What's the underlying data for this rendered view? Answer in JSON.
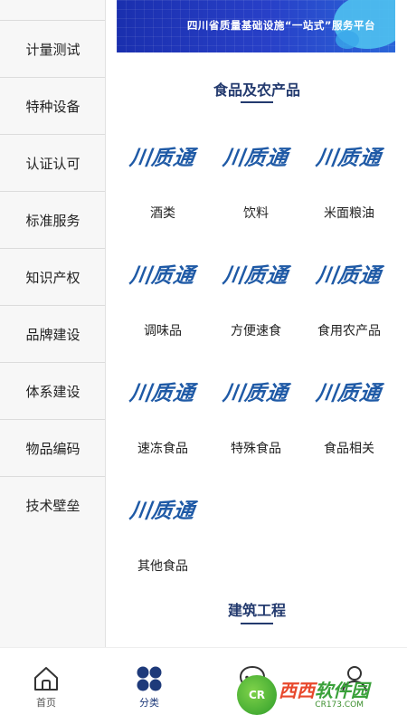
{
  "sidebar": {
    "items": [
      {
        "label": "计量测试"
      },
      {
        "label": "特种设备"
      },
      {
        "label": "认证认可"
      },
      {
        "label": "标准服务"
      },
      {
        "label": "知识产权"
      },
      {
        "label": "品牌建设"
      },
      {
        "label": "体系建设"
      },
      {
        "label": "物品编码"
      },
      {
        "label": "技术壁垒"
      }
    ]
  },
  "banner": {
    "text": "四川省质量基础设施“一站式”服务平台"
  },
  "sections": [
    {
      "title": "食品及农产品",
      "items": [
        {
          "logo": "川质通",
          "label": "酒类"
        },
        {
          "logo": "川质通",
          "label": "饮料"
        },
        {
          "logo": "川质通",
          "label": "米面粮油"
        },
        {
          "logo": "川质通",
          "label": "调味品"
        },
        {
          "logo": "川质通",
          "label": "方便速食"
        },
        {
          "logo": "川质通",
          "label": "食用农产品"
        },
        {
          "logo": "川质通",
          "label": "速冻食品"
        },
        {
          "logo": "川质通",
          "label": "特殊食品"
        },
        {
          "logo": "川质通",
          "label": "食品相关"
        },
        {
          "logo": "川质通",
          "label": "其他食品"
        }
      ]
    },
    {
      "title": "建筑工程",
      "items": []
    }
  ],
  "bottom_nav": {
    "items": [
      {
        "label": "首页",
        "icon": "home-icon"
      },
      {
        "label": "分类",
        "icon": "category-icon",
        "active": true
      },
      {
        "label": "",
        "icon": "message-icon"
      },
      {
        "label": "",
        "icon": "user-icon"
      }
    ]
  },
  "watermark": {
    "circle_text": "CR",
    "main_left": "西西",
    "main_right": "软件园",
    "sub": "CR173.COM"
  },
  "colors": {
    "accent": "#233a6e",
    "logo": "#1f5aa6",
    "nav_active": "#1e3a7a"
  }
}
